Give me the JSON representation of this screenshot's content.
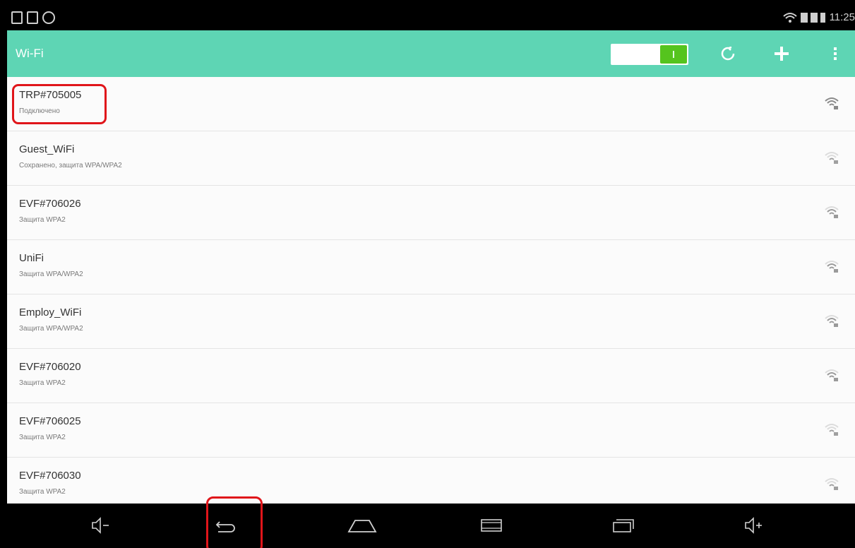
{
  "status_bar": {
    "time": "11:25"
  },
  "action_bar": {
    "title": "Wi-Fi",
    "toggle_on": true,
    "icons": [
      "refresh-icon",
      "add-icon",
      "overflow-menu-icon"
    ]
  },
  "networks": [
    {
      "name": "TRP#705005",
      "status": "Подключено",
      "signal": "strong"
    },
    {
      "name": "Guest_WiFi",
      "status": "Сохранено, защита WPA/WPA2",
      "signal": "weak"
    },
    {
      "name": "EVF#706026",
      "status": "Защита WPA2",
      "signal": "medium"
    },
    {
      "name": "UniFi",
      "status": "Защита WPA/WPA2",
      "signal": "medium"
    },
    {
      "name": "Employ_WiFi",
      "status": "Защита WPA/WPA2",
      "signal": "medium"
    },
    {
      "name": "EVF#706020",
      "status": "Защита WPA2",
      "signal": "medium"
    },
    {
      "name": "EVF#706025",
      "status": "Защита WPA2",
      "signal": "weak"
    },
    {
      "name": "EVF#706030",
      "status": "Защита WPA2",
      "signal": "weak"
    }
  ],
  "nav_bar": {
    "buttons": [
      "volume-down-icon",
      "back-icon",
      "home-icon",
      "screenshot-icon",
      "recent-apps-icon",
      "volume-up-icon"
    ]
  },
  "colors": {
    "accent": "#5ed5b4",
    "toggle_on": "#55c41e",
    "highlight": "#e0151a"
  }
}
